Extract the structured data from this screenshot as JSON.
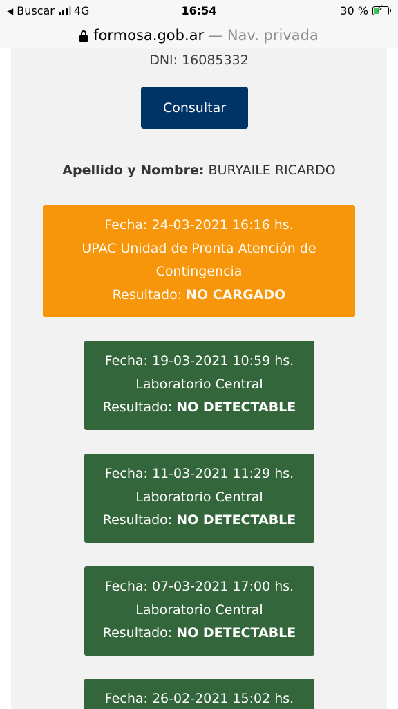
{
  "status_bar": {
    "back_label": "Buscar",
    "network": "4G",
    "time": "16:54",
    "battery_percent": "30 %",
    "battery_level": 0.3
  },
  "address_bar": {
    "domain": "formosa.gob.ar",
    "mode": "— Nav. privada"
  },
  "page": {
    "dni_text": "DNI: 16085332",
    "consult_button": "Consultar",
    "name_label": "Apellido y Nombre:",
    "name_value": "BURYAILE RICARDO"
  },
  "results": [
    {
      "fecha": "Fecha: 24-03-2021 16:16 hs.",
      "lugar_1": "UPAC Unidad de Pronta Atención de",
      "lugar_2": "Contingencia",
      "resultado_label": "Resultado:",
      "resultado_value": "NO CARGADO",
      "color": "#f7960a"
    },
    {
      "fecha": "Fecha: 19-03-2021 10:59 hs.",
      "lugar_1": "Laboratorio Central",
      "resultado_label": "Resultado:",
      "resultado_value": "NO DETECTABLE",
      "color": "#33663a"
    },
    {
      "fecha": "Fecha: 11-03-2021 11:29 hs.",
      "lugar_1": "Laboratorio Central",
      "resultado_label": "Resultado:",
      "resultado_value": "NO DETECTABLE",
      "color": "#33663a"
    },
    {
      "fecha": "Fecha: 07-03-2021 17:00 hs.",
      "lugar_1": "Laboratorio Central",
      "resultado_label": "Resultado:",
      "resultado_value": "NO DETECTABLE",
      "color": "#33663a"
    },
    {
      "fecha": "Fecha: 26-02-2021 15:02 hs."
    }
  ]
}
